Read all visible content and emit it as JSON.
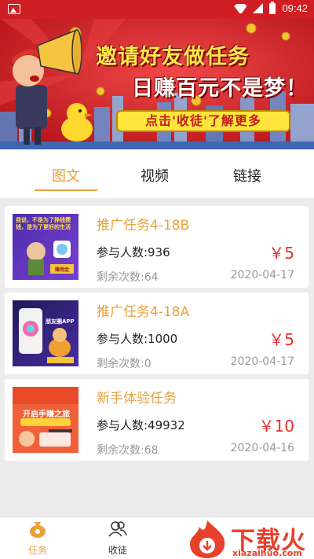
{
  "status_bar": {
    "time": "09:42"
  },
  "banner": {
    "title": "邀请好友做任务",
    "subtitle": "日赚百元不是梦！",
    "button_label": "点击'收徒'了解更多",
    "colors": {
      "background": "#d8242a",
      "title": "#ffe94a",
      "button": "#ffe53b"
    }
  },
  "tabs": [
    {
      "label": "图文",
      "active": true
    },
    {
      "label": "视频",
      "active": false
    },
    {
      "label": "链接",
      "active": false
    }
  ],
  "tasks": [
    {
      "title": "推广任务4-18B",
      "participants": "参与人数:936",
      "price": "￥5",
      "remaining": "剩余次数:64",
      "date": "2020-04-17",
      "thumb_text": "我说，不是为了挣钱攒钱，是为了更好的生活",
      "thumb_tag": "赚佣金"
    },
    {
      "title": "推广任务4-18A",
      "participants": "参与人数:1000",
      "price": "￥5",
      "remaining": "剩余次数:0",
      "date": "2020-04-17",
      "thumb_text": "朋友圈APP"
    },
    {
      "title": "新手体验任务",
      "participants": "参与人数:49932",
      "price": "￥10",
      "remaining": "剩余次数:68",
      "date": "2020-04-16",
      "thumb_text": "开启手赚之旅"
    }
  ],
  "bottom_nav": [
    {
      "label": "任务",
      "icon": "money-bag-icon",
      "active": true
    },
    {
      "label": "收徒",
      "icon": "users-icon",
      "active": false
    }
  ],
  "watermark": {
    "text": "下载火",
    "url": "xiazaihuo.com"
  },
  "colors": {
    "accent": "#e9a03a",
    "price": "#e5302f",
    "status_bar": "#d01f24"
  }
}
